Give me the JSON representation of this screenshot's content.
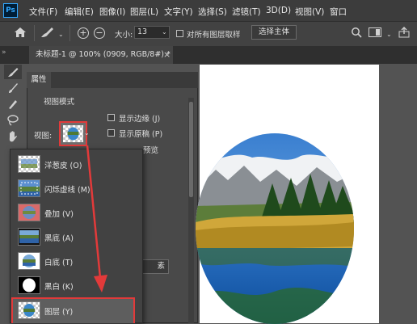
{
  "menubar": {
    "logo": "Ps",
    "items": [
      "文件(F)",
      "编辑(E)",
      "图像(I)",
      "图层(L)",
      "文字(Y)",
      "选择(S)",
      "滤镜(T)",
      "3D(D)",
      "视图(V)",
      "窗口"
    ]
  },
  "options": {
    "size_label": "大小:",
    "size_value": "13",
    "sample_all_label": "对所有图层取样",
    "select_subject": "选择主体"
  },
  "document": {
    "tab_title": "未标题-1 @ 100% (0909, RGB/8#) *",
    "close": "×"
  },
  "properties": {
    "tab": "属性",
    "section": "视图模式",
    "view_label": "视图:",
    "show_edge": "显示边缘 (J)",
    "show_original": "显示原稿 (P)",
    "partial_text": "预览",
    "partial_button": "素"
  },
  "dropdown": {
    "items": [
      {
        "label": "洋葱皮 (O)",
        "thumb": "checker-landscape"
      },
      {
        "label": "闪烁虚线 (M)",
        "thumb": "marching-ants"
      },
      {
        "label": "叠加 (V)",
        "thumb": "red-overlay"
      },
      {
        "label": "黑底 (A)",
        "thumb": "black-bg"
      },
      {
        "label": "白底 (T)",
        "thumb": "white-bg"
      },
      {
        "label": "黑白 (K)",
        "thumb": "black-white"
      },
      {
        "label": "图层 (Y)",
        "thumb": "checker-layer",
        "selected": true
      }
    ]
  },
  "colors": {
    "highlight": "#e23a3a",
    "menubar_bg": "#3c3c3c",
    "panel_bg": "#494949"
  }
}
